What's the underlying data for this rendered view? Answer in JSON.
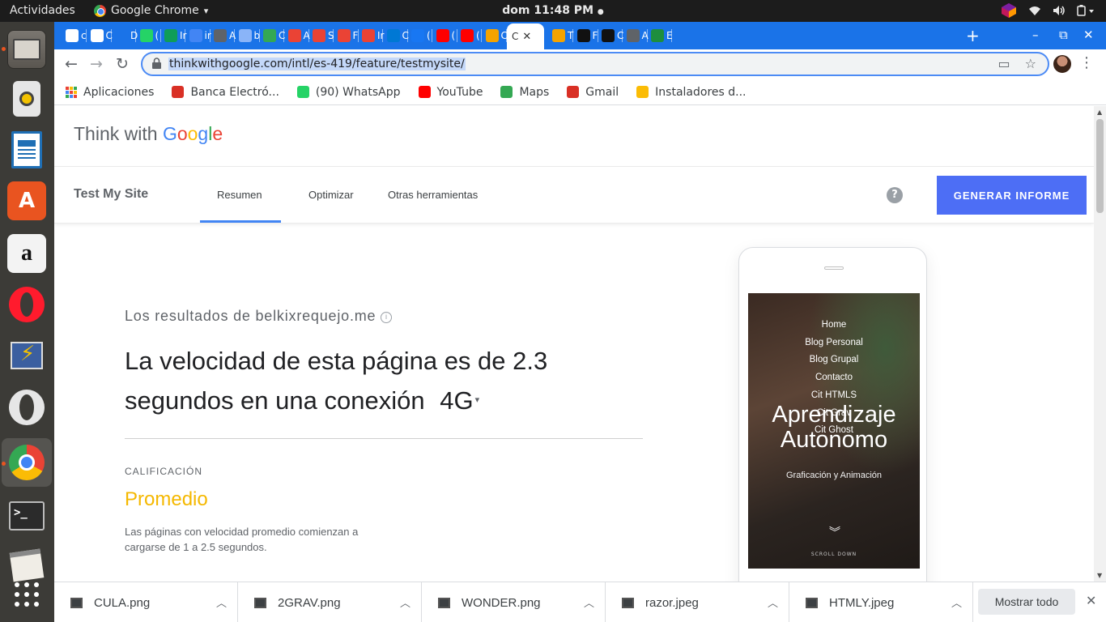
{
  "topbar": {
    "activities": "Actividades",
    "app_name": "Google Chrome",
    "app_caret": "▾",
    "clock": "dom 11:48 PM",
    "clock_dot": "●",
    "tray_icons": [
      "app-indicator-icon",
      "wifi-icon",
      "volume-icon",
      "power-icon"
    ]
  },
  "dock": {
    "items": [
      "files-icon",
      "rhythmbox-icon",
      "libreoffice-writer-icon",
      "software-center-icon",
      "amazon-icon",
      "opera-icon",
      "remote-desktop-icon",
      "opera-gx-icon",
      "chrome-icon",
      "terminal-icon",
      "notes-icon",
      "show-apps-icon"
    ]
  },
  "tabs": {
    "items": [
      {
        "letter": "c",
        "color": "#ffffff"
      },
      {
        "letter": "C",
        "color": "#ffffff"
      },
      {
        "letter": "D",
        "color": "#1a73e8"
      },
      {
        "letter": "(",
        "color": "#25d366"
      },
      {
        "letter": "Ir",
        "color": "#0f9d58"
      },
      {
        "letter": "ir",
        "color": "#4285f4"
      },
      {
        "letter": "A",
        "color": "#5f6368"
      },
      {
        "letter": "b",
        "color": "#8ab4f8"
      },
      {
        "letter": "C",
        "color": "#34a853"
      },
      {
        "letter": "A",
        "color": "#ea4335"
      },
      {
        "letter": "S",
        "color": "#ea4335"
      },
      {
        "letter": "F",
        "color": "#ea4335"
      },
      {
        "letter": "Ir",
        "color": "#ea4335"
      },
      {
        "letter": "C",
        "color": "#0078d4"
      },
      {
        "letter": "(",
        "color": "#1877f2"
      },
      {
        "letter": "(",
        "color": "#ff0000"
      },
      {
        "letter": "(",
        "color": "#ff0000"
      },
      {
        "letter": "C",
        "color": "#f4a300"
      }
    ],
    "active": {
      "letter": "C",
      "close": "✕"
    },
    "after": [
      {
        "letter": "T",
        "color": "#f4a300"
      },
      {
        "letter": "F",
        "color": "#111111"
      },
      {
        "letter": "C",
        "color": "#111111"
      },
      {
        "letter": "A",
        "color": "#5f6368"
      },
      {
        "letter": "E",
        "color": "#1e8e3e"
      }
    ],
    "new_tab": "+",
    "minimize": "–",
    "maximize": "⧉",
    "close": "✕"
  },
  "toolbar": {
    "back": "←",
    "forward": "→",
    "reload": "↻",
    "url": "thinkwithgoogle.com/intl/es-419/feature/testmysite/",
    "cast": "▭",
    "star": "☆",
    "menu": "⋮"
  },
  "bookmarks": [
    {
      "label": "Aplicaciones",
      "icon": "apps-grid-icon",
      "color": "#ea4335"
    },
    {
      "label": "Banca Electró...",
      "icon": "gmail-icon",
      "color": "#d93025"
    },
    {
      "label": "(90) WhatsApp",
      "icon": "whatsapp-icon",
      "color": "#25d366"
    },
    {
      "label": "YouTube",
      "icon": "youtube-icon",
      "color": "#ff0000"
    },
    {
      "label": "Maps",
      "icon": "maps-icon",
      "color": "#34a853"
    },
    {
      "label": "Gmail",
      "icon": "gmail-icon",
      "color": "#d93025"
    },
    {
      "label": "Instaladores d...",
      "icon": "drive-icon",
      "color": "#fbbc05"
    }
  ],
  "page": {
    "logo_prefix": "Think with ",
    "logo_letters": [
      "G",
      "o",
      "o",
      "g",
      "l",
      "e"
    ],
    "product_name": "Test My Site",
    "nav": [
      "Resumen",
      "Optimizar",
      "Otras herramientas"
    ],
    "help": "?",
    "cta": "GENERAR INFORME",
    "results_for": "Los resultados de belkixrequejo.me",
    "info": "i",
    "headline": "La velocidad de esta página es de 2.3 segundos en una conexión",
    "connection": "4G",
    "caret": "▾",
    "rating_label": "CALIFICACIÓN",
    "rating_value": "Promedio",
    "rating_desc": "Las páginas con velocidad promedio comienzan a cargarse de 1 a 2.5 segundos.",
    "rating_color": "#f5b800",
    "cta_color": "#4d6ef5"
  },
  "phone": {
    "menu": [
      "Home",
      "Blog Personal",
      "Blog Grupal",
      "Contacto",
      "Cit HTMLS",
      "Cit Grav",
      "Cit Ghost"
    ],
    "title_line1": "Aprendizaje",
    "title_line2": "Autonomo",
    "subtitle": "Graficación y Animación",
    "chevron": "︾",
    "scroll": "SCROLL DOWN"
  },
  "downloads": {
    "files": [
      "CULA.png",
      "2GRAV.png",
      "WONDER.png",
      "razor.jpeg",
      "HTMLY.jpeg"
    ],
    "chevron": "︿",
    "show_all": "Mostrar todo",
    "close": "✕"
  }
}
